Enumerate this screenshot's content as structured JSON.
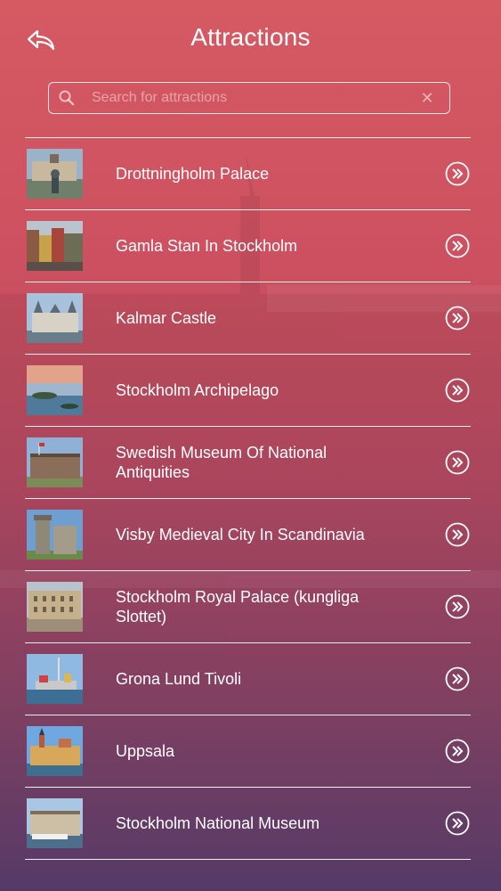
{
  "header": {
    "title": "Attractions",
    "back_icon": "back-arrow-icon"
  },
  "search": {
    "placeholder": "Search for attractions",
    "value": "",
    "search_icon": "search-icon",
    "clear_icon": "clear-icon"
  },
  "attractions": [
    {
      "label": "Drottningholm Palace",
      "action_icon": "chevron-circle-icon"
    },
    {
      "label": "Gamla Stan In Stockholm",
      "action_icon": "chevron-circle-icon"
    },
    {
      "label": "Kalmar Castle",
      "action_icon": "chevron-circle-icon"
    },
    {
      "label": "Stockholm Archipelago",
      "action_icon": "chevron-circle-icon"
    },
    {
      "label": "Swedish Museum Of National Antiquities",
      "action_icon": "chevron-circle-icon"
    },
    {
      "label": "Visby Medieval City In Scandinavia",
      "action_icon": "chevron-circle-icon"
    },
    {
      "label": "Stockholm Royal Palace (kungliga Slottet)",
      "action_icon": "chevron-circle-icon"
    },
    {
      "label": "Grona Lund Tivoli",
      "action_icon": "chevron-circle-icon"
    },
    {
      "label": "Uppsala",
      "action_icon": "chevron-circle-icon"
    },
    {
      "label": "Stockholm National Museum",
      "action_icon": "chevron-circle-icon"
    }
  ],
  "colors": {
    "gradient_top": "#d65a62",
    "gradient_bottom": "#5a3e6e",
    "line": "#ffffff"
  }
}
